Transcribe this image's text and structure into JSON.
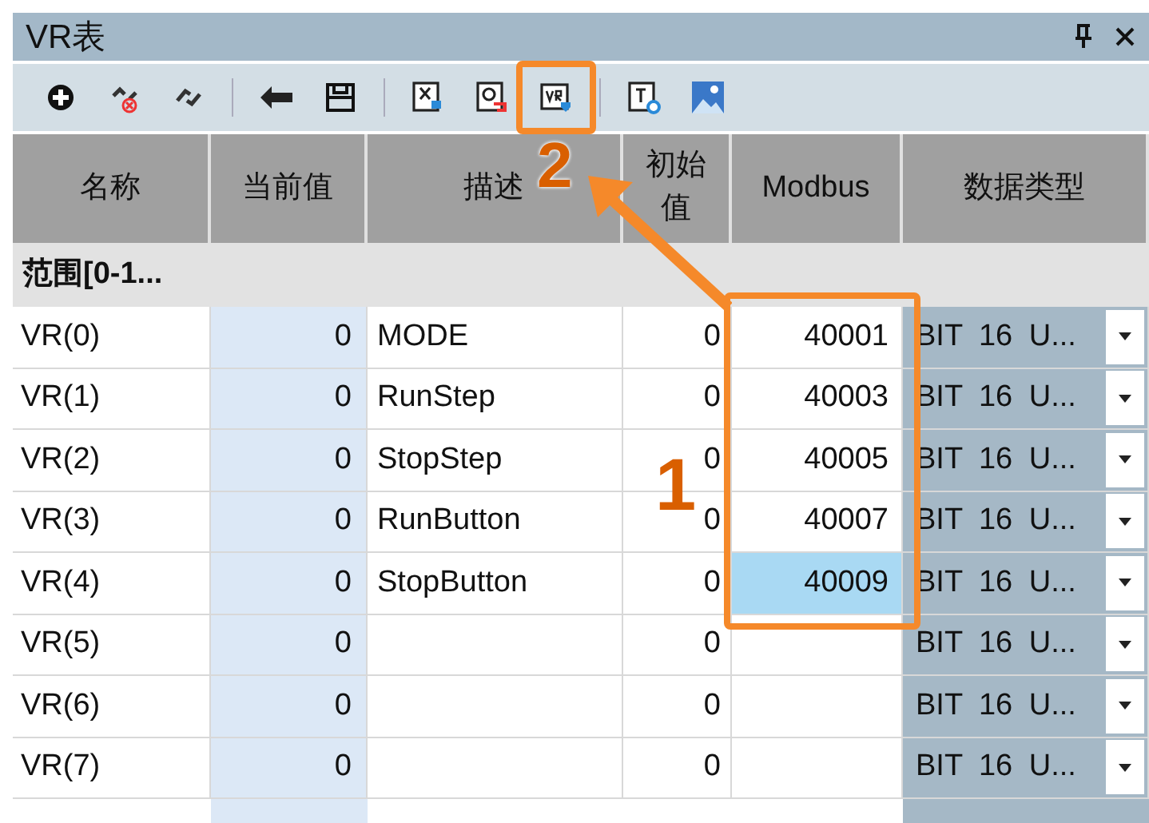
{
  "window": {
    "title": "VR表"
  },
  "toolbar": [
    {
      "kind": "add",
      "highlighted": false
    },
    {
      "kind": "unlink",
      "highlighted": false
    },
    {
      "kind": "link",
      "highlighted": false
    },
    {
      "kind": "separator"
    },
    {
      "kind": "csv",
      "highlighted": false
    },
    {
      "kind": "save",
      "highlighted": false
    },
    {
      "kind": "separator"
    },
    {
      "kind": "import-x",
      "highlighted": false
    },
    {
      "kind": "import-o",
      "highlighted": false
    },
    {
      "kind": "import-vr",
      "highlighted": true
    },
    {
      "kind": "separator"
    },
    {
      "kind": "text-t",
      "highlighted": false
    },
    {
      "kind": "image",
      "highlighted": false
    }
  ],
  "table": {
    "columns": [
      "名称",
      "当前值",
      "描述",
      "初始值",
      "Modbus",
      "数据类型"
    ],
    "group": "范围[0-1...",
    "rows": [
      {
        "name": "VR(0)",
        "current": "0",
        "description": "MODE",
        "initial": "0",
        "modbus": "40001",
        "modbus_selected": false,
        "type": "BIT 16 U..."
      },
      {
        "name": "VR(1)",
        "current": "0",
        "description": "RunStep",
        "initial": "0",
        "modbus": "40003",
        "modbus_selected": false,
        "type": "BIT 16 U..."
      },
      {
        "name": "VR(2)",
        "current": "0",
        "description": "StopStep",
        "initial": "0",
        "modbus": "40005",
        "modbus_selected": false,
        "type": "BIT 16 U..."
      },
      {
        "name": "VR(3)",
        "current": "0",
        "description": "RunButton",
        "initial": "0",
        "modbus": "40007",
        "modbus_selected": false,
        "type": "BIT 16 U..."
      },
      {
        "name": "VR(4)",
        "current": "0",
        "description": "StopButton",
        "initial": "0",
        "modbus": "40009",
        "modbus_selected": true,
        "type": "BIT 16 U..."
      },
      {
        "name": "VR(5)",
        "current": "0",
        "initial": "0",
        "modbus_selected": false,
        "type": "BIT 16 U..."
      },
      {
        "name": "VR(6)",
        "current": "0",
        "initial": "0",
        "modbus_selected": false,
        "type": "BIT 16 U..."
      },
      {
        "name": "VR(7)",
        "current": "0",
        "initial": "0",
        "modbus_selected": false,
        "type": "BIT 16 U..."
      }
    ]
  },
  "annotations": [
    {
      "label": "1"
    },
    {
      "label": "2"
    }
  ]
}
